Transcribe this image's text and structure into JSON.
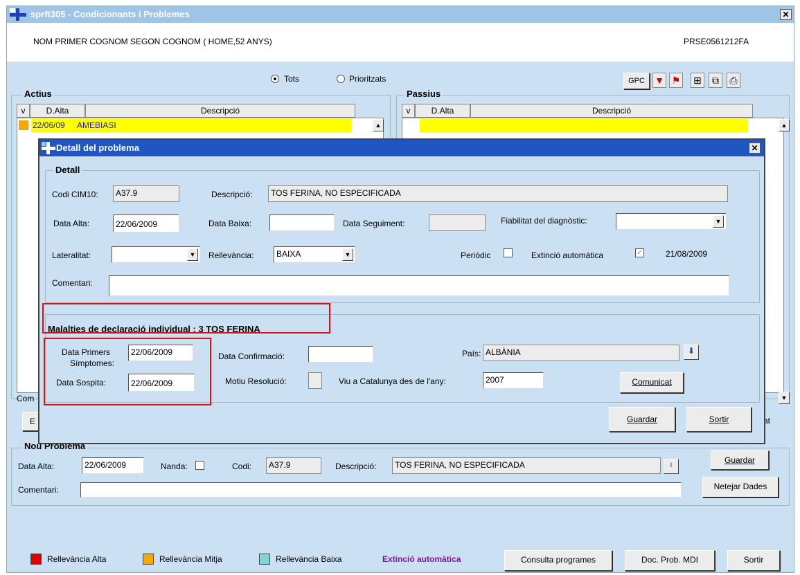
{
  "window": {
    "title": "sprft305 - Condicionants i Problemes",
    "close": "✕"
  },
  "patient": {
    "name": "NOM PRIMER COGNOM SEGON COGNOM   ( HOME,52 ANYS)",
    "code": "PRSE0561212FA"
  },
  "filter": {
    "all_label": "Tots",
    "priority_label": "Prioritzats",
    "selected": "Tots"
  },
  "toolbar": {
    "gpc_label": "GPC"
  },
  "actius": {
    "title": "Actius",
    "headers": [
      "v",
      "D.Alta",
      "Descripció"
    ],
    "rows": [
      {
        "date": "22/06/09",
        "desc": "AMEBIASI"
      }
    ]
  },
  "passius": {
    "title": "Passius",
    "headers": [
      "v",
      "D.Alta",
      "Descripció"
    ]
  },
  "fragments": {
    "com": "Com",
    "b": "E",
    "at": "at"
  },
  "dialog": {
    "title": "Detall del problema",
    "detall_title": "Detall",
    "codi_label": "Codi CIM10:",
    "codi_value": "A37.9",
    "desc_label": "Descripció:",
    "desc_value": "TOS FERINA, NO ESPECIFICADA",
    "data_alta_label": "Data  Alta:",
    "data_alta_value": "22/06/2009",
    "data_baixa_label": "Data Baixa:",
    "data_baixa_value": "",
    "data_seg_label": "Data Seguiment:",
    "data_seg_value": "",
    "fiab_label": "Fiabilitat del diagnòstic:",
    "fiab_value": "",
    "lat_label": "Lateralitat:",
    "lat_value": "",
    "rell_label": "Rellevància:",
    "rell_value": "BAIXA",
    "periodic_label": "Periòdic",
    "periodic_checked": false,
    "extincio_label": "Extinció automàtica",
    "extincio_checked": true,
    "extincio_date": "21/08/2009",
    "comentari_label": "Comentari:",
    "comentari_value": "",
    "mdi_title": "Malalties de declaració individual : 3  TOS FERINA",
    "primers_label_1": "Data Primers",
    "primers_label_2": "Símptomes:",
    "primers_value": "22/06/2009",
    "sospita_label": "Data Sospita:",
    "sospita_value": "22/06/2009",
    "confirm_label": "Data Confirmació:",
    "confirm_value": "",
    "motiu_label": "Motiu Resolució:",
    "pais_label": "País:",
    "pais_value": "ALBÀNIA",
    "viu_label": "Viu a Catalunya des de l'any:",
    "viu_value": "2007",
    "comunicat_label": "Comunicat",
    "guardar_label": "Guardar",
    "sortir_label": "Sortir"
  },
  "nou": {
    "title": "Nou Problema",
    "data_alta_label": "Data  Alta:",
    "data_alta_value": "22/06/2009",
    "nanda_label": "Nanda:",
    "codi_label": "Codi:",
    "codi_value": "A37.9",
    "desc_label": "Descripció:",
    "desc_value": "TOS FERINA, NO ESPECIFICADA",
    "comentari_label": "Comentari:",
    "guardar_label": "Guardar",
    "netejar_label": "Netejar Dades"
  },
  "legend": {
    "alta": "Rellevància Alta",
    "mitja": "Rellevància Mitja",
    "baixa": "Rellevància Baixa",
    "extincio": "Extinció automàtica",
    "colors": {
      "alta": "#e00000",
      "mitja": "#f5a800",
      "baixa": "#7fd6d6",
      "extincio": "#7a1a8a"
    }
  },
  "footer": {
    "consulta_label": "Consulta programes",
    "doc_label": "Doc. Prob. MDI",
    "sortir_label": "Sortir"
  }
}
